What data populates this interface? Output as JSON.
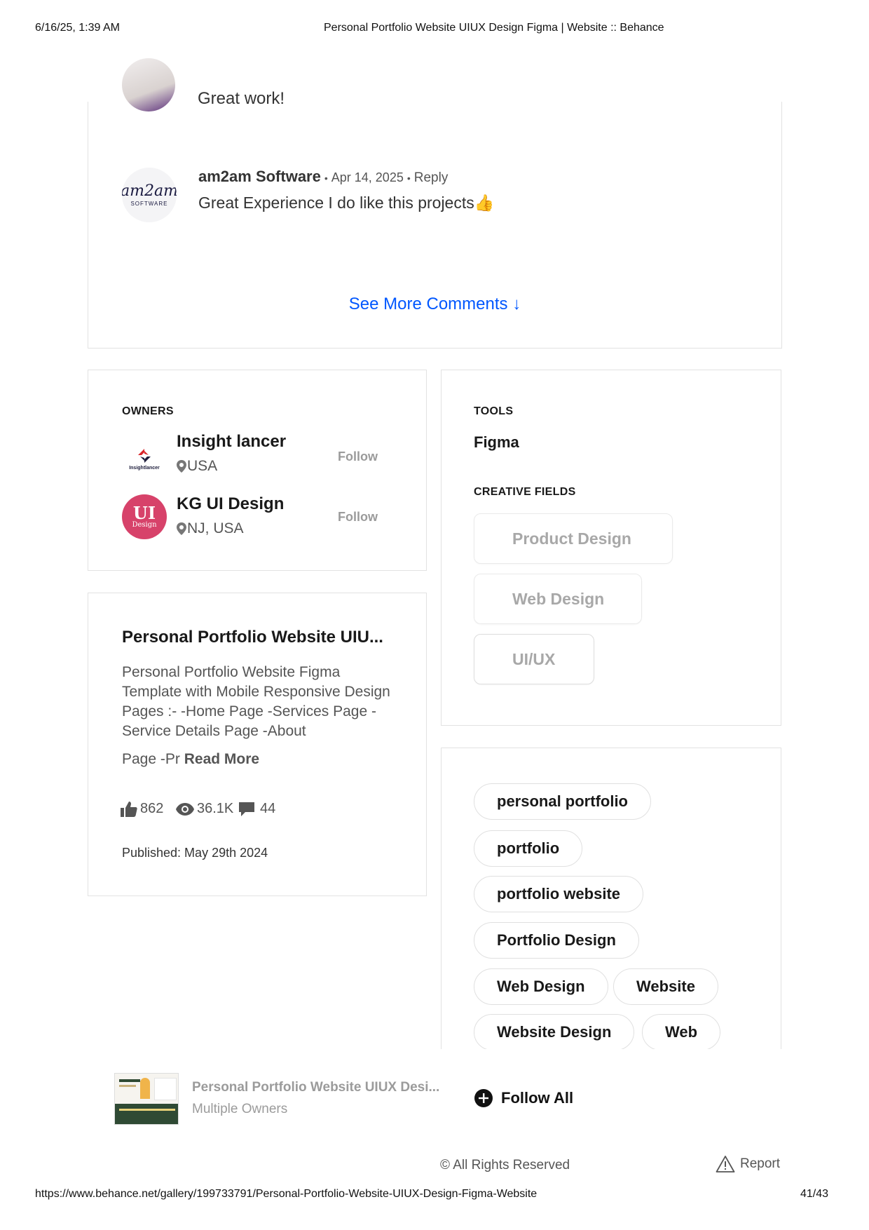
{
  "print_header": {
    "datetime": "6/16/25, 1:39 AM",
    "page_title": "Personal Portfolio Website UIUX Design Figma | Website :: Behance"
  },
  "comments": {
    "partial_text": "Great work!",
    "items": [
      {
        "author": "am2am Software",
        "separator": "•",
        "date": "Apr 14, 2025",
        "reply_label": "Reply",
        "text": "Great Experience I do like this projects",
        "emoji": "👍",
        "avatar_logo_top": "am2am",
        "avatar_logo_bottom": "SOFTWARE"
      }
    ],
    "see_more_label": "See More Comments",
    "see_more_arrow": "↓"
  },
  "owners": {
    "title": "OWNERS",
    "items": [
      {
        "name": "Insight lancer",
        "location": "USA",
        "follow_label": "Follow",
        "logo_text": "Insightlancer"
      },
      {
        "name": "KG UI Design",
        "location": "NJ, USA",
        "follow_label": "Follow",
        "logo_top": "UI",
        "logo_bottom": "Design"
      }
    ]
  },
  "project_info": {
    "title": "Personal Portfolio Website UIU...",
    "description": "Personal Portfolio Website Figma Template with Mobile Responsive Design Pages :- -Home Page -Services Page -Service Details Page -About",
    "description_tail": "Page -Pr",
    "read_more_label": "Read More",
    "stats": {
      "appreciations": "862",
      "views": "36.1K",
      "comments": "44"
    },
    "published": "Published: May 29th 2024"
  },
  "tools": {
    "title": "TOOLS",
    "items": [
      "Figma"
    ],
    "creative_fields_title": "CREATIVE FIELDS",
    "creative_fields": [
      "Product Design",
      "Web Design",
      "UI/UX"
    ]
  },
  "tags": [
    "personal portfolio",
    "portfolio",
    "portfolio website",
    "Portfolio Design",
    "Web Design",
    "Website",
    "Website Design",
    "Web"
  ],
  "footer_bar": {
    "project_title": "Personal Portfolio Website UIUX Desi...",
    "owners_label": "Multiple Owners",
    "follow_all_label": "Follow All"
  },
  "page_footer": {
    "rights": "© All Rights Reserved",
    "report_label": "Report"
  },
  "print_footer": {
    "url": "https://www.behance.net/gallery/199733791/Personal-Portfolio-Website-UIUX-Design-Figma-Website",
    "page_number": "41/43"
  },
  "colors": {
    "link_blue": "#0057ff",
    "border": "#e2e2e2",
    "kg_logo": "#d7426a"
  }
}
